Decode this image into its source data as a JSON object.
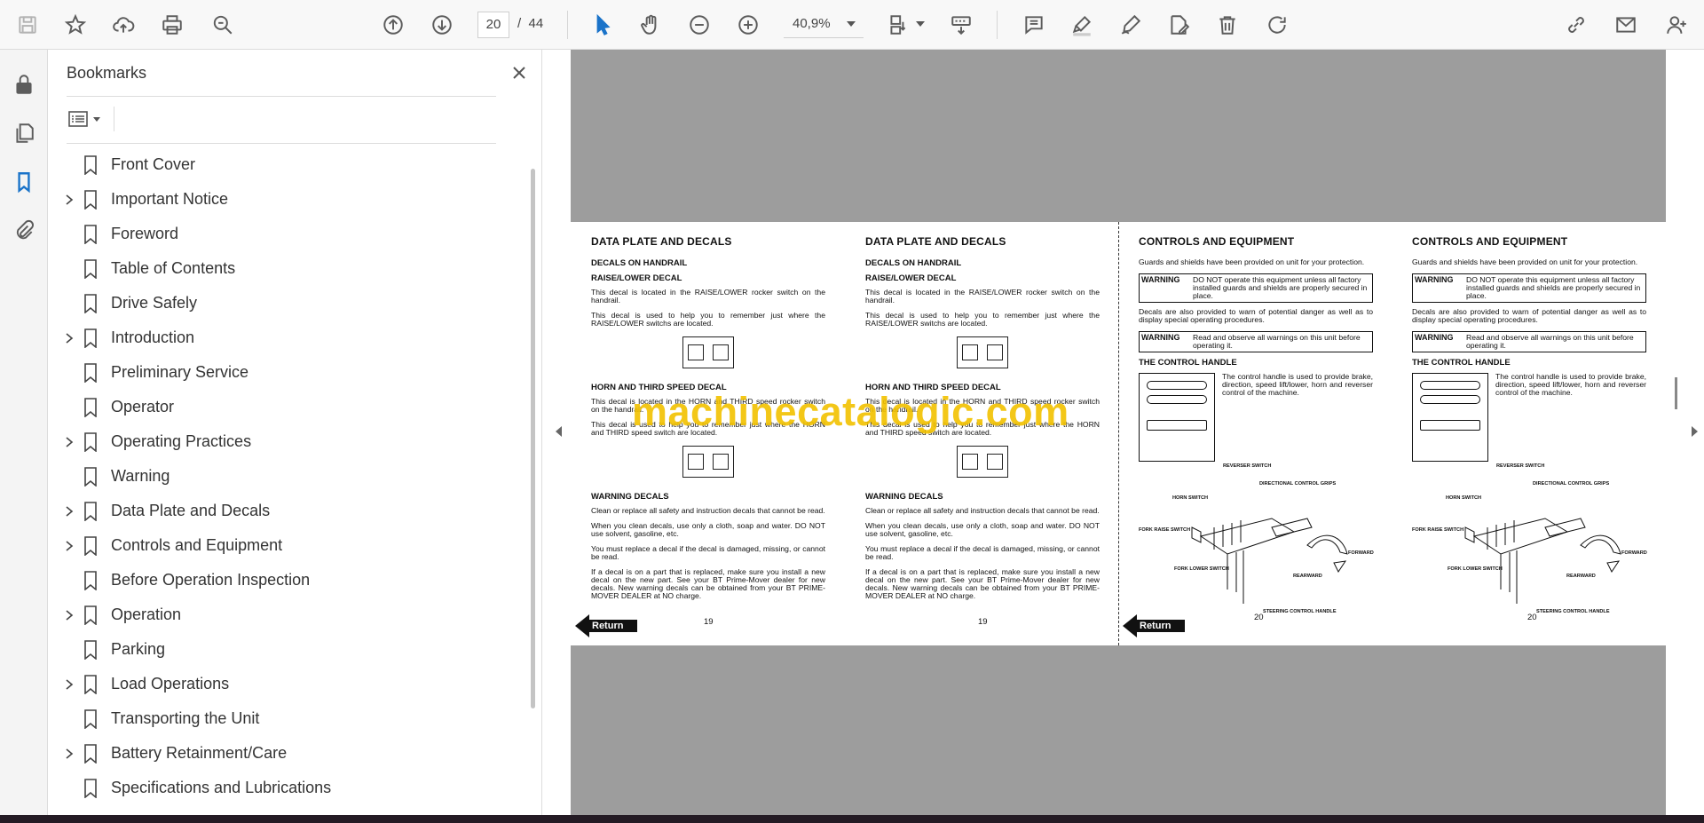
{
  "toolbar": {
    "page_current": "20",
    "page_separator": "/",
    "page_total": "44",
    "zoom": "40,9%"
  },
  "bookmarks": {
    "title": "Bookmarks",
    "items": [
      {
        "label": "Front Cover",
        "expandable": false
      },
      {
        "label": "Important Notice",
        "expandable": true
      },
      {
        "label": "Foreword",
        "expandable": false
      },
      {
        "label": "Table of Contents",
        "expandable": false
      },
      {
        "label": "Drive Safely",
        "expandable": false
      },
      {
        "label": "Introduction",
        "expandable": true
      },
      {
        "label": "Preliminary Service",
        "expandable": false
      },
      {
        "label": "Operator",
        "expandable": false
      },
      {
        "label": "Operating Practices",
        "expandable": true
      },
      {
        "label": "Warning",
        "expandable": false
      },
      {
        "label": "Data Plate and Decals",
        "expandable": true
      },
      {
        "label": "Controls and Equipment",
        "expandable": true
      },
      {
        "label": "Before Operation Inspection",
        "expandable": false
      },
      {
        "label": "Operation",
        "expandable": true
      },
      {
        "label": "Parking",
        "expandable": false
      },
      {
        "label": "Load Operations",
        "expandable": true
      },
      {
        "label": "Transporting the Unit",
        "expandable": false
      },
      {
        "label": "Battery Retainment/Care",
        "expandable": true
      },
      {
        "label": "Specifications and Lubrications",
        "expandable": false
      }
    ]
  },
  "doc": {
    "watermark": "machinecatalogic.com",
    "return_label": "Return",
    "left": {
      "title": "DATA PLATE AND DECALS",
      "sub1": "DECALS ON HANDRAIL",
      "sub2": "RAISE/LOWER DECAL",
      "p1": "This decal is located in the RAISE/LOWER rocker switch on the handrail.",
      "p2": "This decal is used to help you to remember just where the RAISE/LOWER switchs are located.",
      "sub3": "HORN AND THIRD SPEED DECAL",
      "p3": "This decal is located in the HORN and THIRD speed rocker switch on the handrail.",
      "p4": "This decal is used to help you to remember just where the HORN and THIRD speed switch are located.",
      "sub4": "WARNING DECALS",
      "p5": "Clean or replace all safety and instruction decals that cannot be read.",
      "p6": "When you clean decals, use only a cloth, soap and water. DO NOT use solvent, gasoline, etc.",
      "p7": "You must replace a decal if the decal is damaged, missing, or cannot be read.",
      "p8": "If a decal is on a part that is replaced, make sure you install a new decal on the new part. See your BT Prime-Mover dealer for new decals. New warning decals can be obtained from your BT PRIME-MOVER DEALER at NO charge.",
      "page": "19"
    },
    "right": {
      "title": "CONTROLS AND EQUIPMENT",
      "p1": "Guards and shields have been provided on unit for your protection.",
      "warn_tag": "WARNING",
      "w1": "DO NOT operate this equipment unless all factory installed guards and shields are properly secured in place.",
      "p2": "Decals are also provided to warn of potential danger as well as to display special operating procedures.",
      "w2": "Read and observe all warnings on this unit before operating it.",
      "sub1": "THE CONTROL HANDLE",
      "p3": "The control handle is used to provide brake, direction, speed lift/lower, horn and reverser control of the machine.",
      "lbl_reverser": "REVERSER SWITCH",
      "lbl_directional": "DIRECTIONAL CONTROL GRIPS",
      "lbl_horn": "HORN SWITCH",
      "lbl_fork_raise": "FORK RAISE SWITCH",
      "lbl_forward": "FORWARD",
      "lbl_fork_lower": "FORK LOWER SWITCH",
      "lbl_rearward": "REARWARD",
      "lbl_steering": "STEERING CONTROL HANDLE",
      "page": "20"
    }
  }
}
